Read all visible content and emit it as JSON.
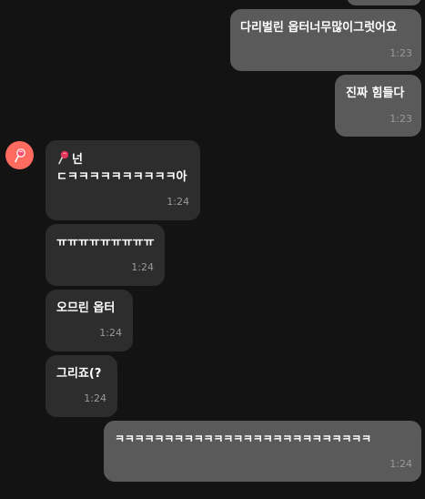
{
  "messages": [
    {
      "direction": "outgoing",
      "text": "",
      "time": ""
    },
    {
      "direction": "outgoing",
      "text": "다리벌린 옵터너무많이그럿어요",
      "time": "1:23"
    },
    {
      "direction": "outgoing",
      "text": "진짜 힘들다",
      "time": "1:23"
    },
    {
      "direction": "incoming",
      "sender": "넌",
      "sender_emoji": "lollipop-icon",
      "text": "ㄷㅋㅋㅋㅋㅋㅋㅋㅋㅋㅋ아",
      "time": "1:24"
    },
    {
      "direction": "incoming",
      "text": "ㅠㅠㅠㅠㅠㅠㅠㅠㅠ",
      "time": "1:24"
    },
    {
      "direction": "incoming",
      "text": "오므린 옵터",
      "time": "1:24"
    },
    {
      "direction": "incoming",
      "text": "그리죠(?",
      "time": "1:24"
    },
    {
      "direction": "outgoing",
      "text": "ㅋㅋㅋㅋㅋㅋㅋㅋㅋㅋㅋㅋㅋㅋㅋㅋㅋㅋㅋㅋㅋㅋㅋㅋㅋㅋ",
      "time": "1:24"
    }
  ],
  "colors": {
    "background": "#131313",
    "outgoing_bubble": "#5a5a5a",
    "incoming_bubble": "#2d2d2d",
    "avatar": "#ff6b5e",
    "text": "#ffffff",
    "time": "#9a9a9a"
  },
  "avatar": {
    "icon": "lollipop-icon"
  }
}
